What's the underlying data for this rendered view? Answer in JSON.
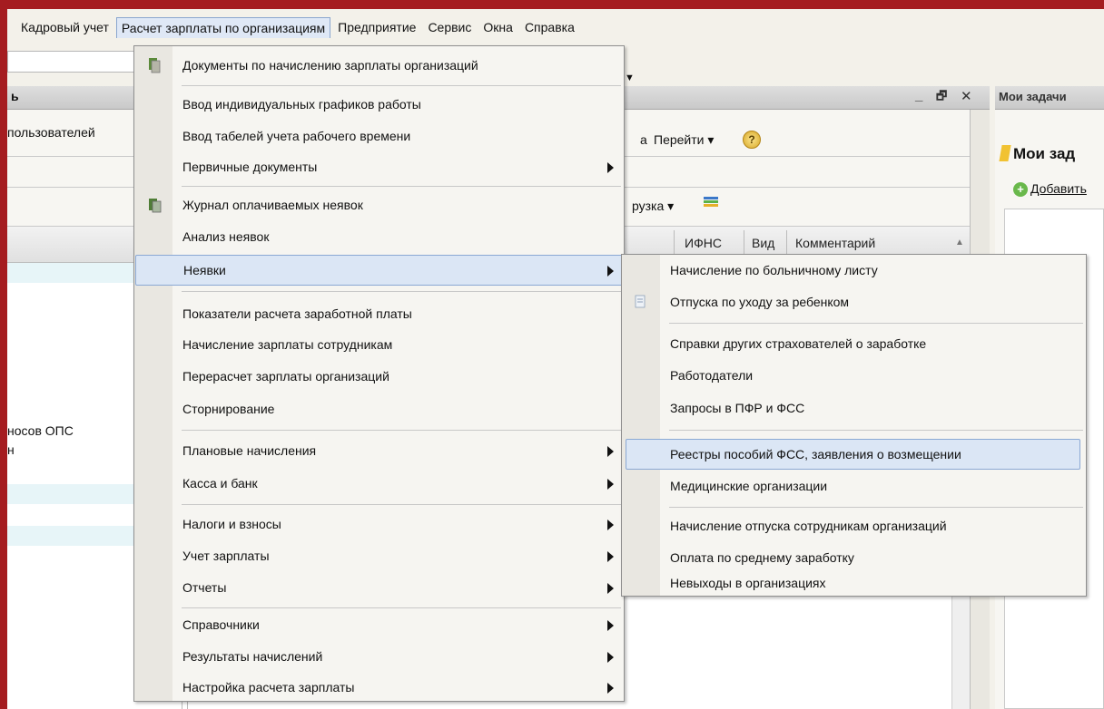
{
  "menubar": {
    "items": [
      "Кадровый учет",
      "Расчет зарплаты по организациям",
      "Предприятие",
      "Сервис",
      "Окна",
      "Справка"
    ]
  },
  "background_window": {
    "title_fragment": "ь",
    "toolbar_fragment": "пользователей",
    "toolbar_a": "а",
    "goto_label": "Перейти ▾",
    "upload_label": "рузка ▾",
    "columns": [
      "ИФНС",
      "Вид",
      "Комментарий"
    ],
    "row_fragment_1": "носов ОПС",
    "row_fragment_2": "н"
  },
  "right_pane": {
    "title": "Мои задачи",
    "heading": "Мои зад",
    "add_label": "Добавить"
  },
  "main_menu": {
    "items": [
      {
        "label": "Документы по начислению зарплаты организаций",
        "icon": "documents-icon"
      },
      {
        "label": "Ввод индивидуальных графиков работы"
      },
      {
        "label": "Ввод табелей учета рабочего времени"
      },
      {
        "label": "Первичные документы",
        "submenu": true
      },
      {
        "label": "Журнал оплачиваемых неявок",
        "icon": "journal-icon"
      },
      {
        "label": "Анализ неявок"
      },
      {
        "label": "Неявки",
        "submenu": true,
        "highlighted": true
      },
      {
        "label": "Показатели расчета заработной платы"
      },
      {
        "label": "Начисление зарплаты сотрудникам"
      },
      {
        "label": "Перерасчет зарплаты организаций"
      },
      {
        "label": "Сторнирование"
      },
      {
        "label": "Плановые начисления",
        "submenu": true
      },
      {
        "label": "Касса и банк",
        "submenu": true
      },
      {
        "label": "Налоги и взносы",
        "submenu": true
      },
      {
        "label": "Учет зарплаты",
        "submenu": true
      },
      {
        "label": "Отчеты",
        "submenu": true
      },
      {
        "label": "Справочники",
        "submenu": true
      },
      {
        "label": "Результаты начислений",
        "submenu": true
      },
      {
        "label": "Настройка расчета зарплаты",
        "submenu": true
      }
    ]
  },
  "sub_menu": {
    "items": [
      {
        "label": "Начисление по больничному листу"
      },
      {
        "label": "Отпуска по уходу за ребенком",
        "icon": "document-icon"
      },
      {
        "label": "Справки других страхователей о заработке"
      },
      {
        "label": "Работодатели"
      },
      {
        "label": "Запросы в ПФР и ФСС"
      },
      {
        "label": "Реестры пособий ФСС, заявления о возмещении",
        "highlighted": true
      },
      {
        "label": "Медицинские организации"
      },
      {
        "label": "Начисление отпуска сотрудникам организаций"
      },
      {
        "label": "Оплата по среднему заработку"
      },
      {
        "label": "Невыходы в организациях"
      }
    ]
  },
  "colors": {
    "frame": "#a51c20",
    "highlight": "#dbe6f5",
    "highlight_border": "#8aa8d4"
  }
}
